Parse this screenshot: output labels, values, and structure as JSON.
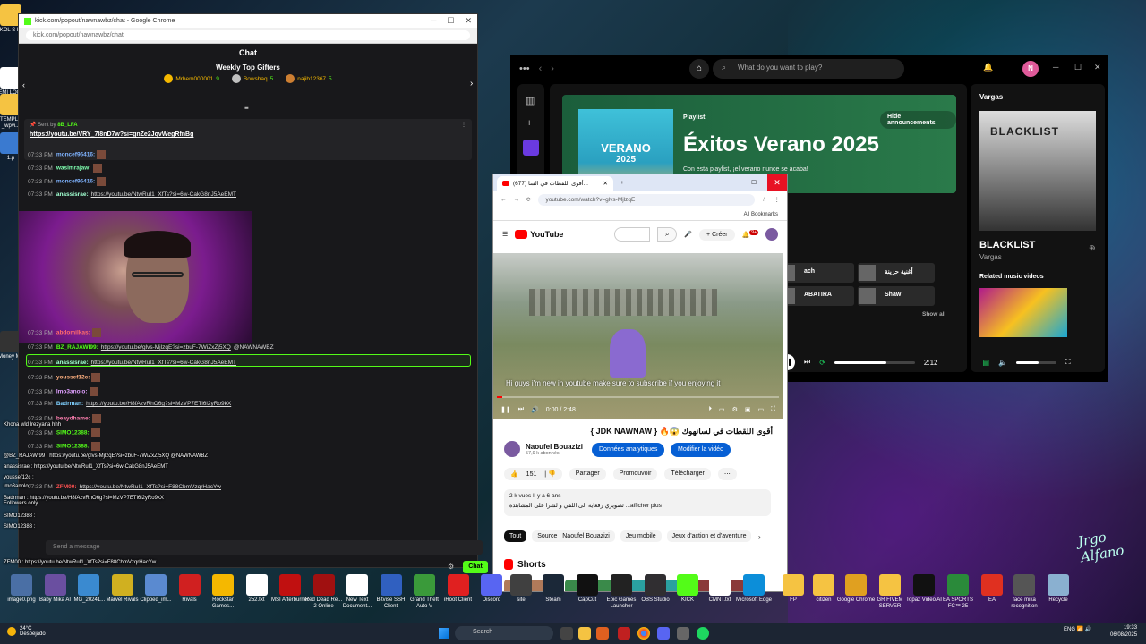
{
  "desktop": {
    "left_icons": [
      {
        "label": "KOL S\nKi",
        "icon": "folder-icon",
        "color": "#f5c342"
      },
      {
        "label": "TEMI\nLOGIN",
        "icon": "file-icon",
        "color": "#ffffff"
      },
      {
        "label": "TEMPLA\n_wpvi...",
        "icon": "folder-icon",
        "color": "#f5c342"
      },
      {
        "label": "1.p",
        "icon": "file-icon",
        "color": "#3a7ad0"
      },
      {
        "label": "Money\nMu",
        "icon": "app-icon",
        "color": "#333333"
      }
    ],
    "bottom_icons": [
      {
        "label": "image0.png",
        "icon": "image-icon",
        "color": "#4a6fa5"
      },
      {
        "label": "Baby Mika AI",
        "icon": "app-icon",
        "color": "#6a4fa0"
      },
      {
        "label": "IMG_20241...",
        "icon": "image-icon",
        "color": "#3a8ad0"
      },
      {
        "label": "Marvel Rivals",
        "icon": "game-icon",
        "color": "#d0b020"
      },
      {
        "label": "Clipped_im...",
        "icon": "file-icon",
        "color": "#5a8ad0"
      },
      {
        "label": "Rivals",
        "icon": "game-icon",
        "color": "#d02020"
      },
      {
        "label": "Rockstar\nGames...",
        "icon": "rockstar-icon",
        "color": "#f5b800"
      },
      {
        "label": "252.txt",
        "icon": "file-icon",
        "color": "#ffffff"
      },
      {
        "label": "MSI\nAfterburner",
        "icon": "app-icon",
        "color": "#c01010"
      },
      {
        "label": "Red Dead\nRe... 2 Online",
        "icon": "game-icon",
        "color": "#a01010"
      },
      {
        "label": "New Text\nDocument...",
        "icon": "file-icon",
        "color": "#ffffff"
      },
      {
        "label": "Bitvise SSH\nClient",
        "icon": "app-icon",
        "color": "#3060c0"
      },
      {
        "label": "Grand Theft\nAuto V",
        "icon": "game-icon",
        "color": "#3a9a3a"
      },
      {
        "label": "iRoot Client",
        "icon": "app-icon",
        "color": "#e02020"
      },
      {
        "label": "Discord",
        "icon": "discord-icon",
        "color": "#5865f2"
      }
    ],
    "right_icons": [
      {
        "label": "site",
        "icon": "app-icon",
        "color": "#404040"
      },
      {
        "label": "Steam",
        "icon": "steam-icon",
        "color": "#1b2838"
      },
      {
        "label": "CapCut",
        "icon": "app-icon",
        "color": "#111111"
      },
      {
        "label": "Epic Games\nLauncher",
        "icon": "app-icon",
        "color": "#222222"
      },
      {
        "label": "OBS Studio",
        "icon": "obs-icon",
        "color": "#302e31"
      },
      {
        "label": "KICK",
        "icon": "kick-icon",
        "color": "#53fc18"
      },
      {
        "label": "CMNT.txt",
        "icon": "file-icon",
        "color": "#ffffff"
      },
      {
        "label": "Microsoft\nEdge",
        "icon": "edge-icon",
        "color": "#0c8ed9"
      },
      {
        "label": "FP",
        "icon": "folder-icon",
        "color": "#f5c342"
      },
      {
        "label": "citizen",
        "icon": "folder-icon",
        "color": "#f5c342"
      },
      {
        "label": "Google\nChrome",
        "icon": "chrome-icon",
        "color": "#e0a020"
      },
      {
        "label": "GR FIVEM\nSERVER",
        "icon": "folder-icon",
        "color": "#f5c342"
      },
      {
        "label": "Topaz Video\nAI",
        "icon": "app-icon",
        "color": "#111111"
      },
      {
        "label": "EA SPORTS\nFC™ 25",
        "icon": "game-icon",
        "color": "#2a8a3a"
      },
      {
        "label": "EA",
        "icon": "ea-icon",
        "color": "#e03020"
      },
      {
        "label": "face mika\nrecognition",
        "icon": "app-icon",
        "color": "#555555"
      },
      {
        "label": "Recycle",
        "icon": "recycle-icon",
        "color": "#8ab0d0"
      }
    ],
    "wallpaper_signature": "Jrgo Alfano"
  },
  "kick": {
    "window_title": "kick.com/popout/nawnawbz/chat - Google Chrome",
    "url": "kick.com/popout/nawnawbz/chat",
    "chat_header": "Chat",
    "gifters_title": "Weekly Top Gifters",
    "gifters": [
      {
        "name": "Mrhem000001",
        "count": "9",
        "medal_color": "#f5b800"
      },
      {
        "name": "Bowshaq",
        "count": "5",
        "medal_color": "#c0c0c0"
      },
      {
        "name": "najib12367",
        "count": "5",
        "medal_color": "#cd7f32"
      }
    ],
    "pinned": {
      "sent_by": "Sent by",
      "sender": "8B_LFA",
      "link": "https://youtu.be/VRY_7l8nD7w?si=gnZe2JqvWegRfnBg"
    },
    "messages": [
      {
        "time": "07:33 PM",
        "user": "moncef96416:",
        "color": "#7fb3ff",
        "text": "",
        "is_link": false
      },
      {
        "time": "07:33 PM",
        "user": "wasimrajaw:",
        "color": "#7fffb0",
        "text": "",
        "is_link": false
      },
      {
        "time": "07:33 PM",
        "user": "moncef96416:",
        "color": "#7fb3ff",
        "text": "",
        "is_link": false
      },
      {
        "time": "07:33 PM",
        "user": "anassisrae:",
        "color": "#a0ffd0",
        "text": "https://youtu.be/NtwRuI1_XfTs?si=6w-CakG8nJ5AeEMT",
        "is_link": true
      }
    ],
    "messages_bottom": [
      {
        "time": "07:33 PM",
        "user": "abdomilkas:",
        "color": "#ff6b6b",
        "text": "",
        "is_link": false
      },
      {
        "time": "07:33 PM",
        "user": "BZ_RAJAWI99:",
        "color": "#53fc18",
        "text": "https://youtu.be/glvs-MjlzqE?si=zbuF-7WiZxZj5XQ",
        "suffix": "@NAWNAWBZ",
        "is_link": true
      },
      {
        "time": "07:33 PM",
        "user": "anassisrae:",
        "color": "#a0ffd0",
        "text": "https://youtu.be/NtwRuI1_XfTs?si=6w-CakG8nJ5AeEMT",
        "is_link": true
      },
      {
        "time": "07:33 PM",
        "user": "youssef12c:",
        "color": "#ffb07f",
        "text": "",
        "is_link": false
      },
      {
        "time": "07:33 PM",
        "user": "lmo3anolo:",
        "color": "#e0a0ff",
        "text": "",
        "is_link": false
      },
      {
        "time": "07:33 PM",
        "user": "Badrman:",
        "color": "#7fd0ff",
        "text": "https://youtu.be/H8fAzvRhO6g?si=MzVP7ETl6i2yRo9kX",
        "is_link": true
      },
      {
        "time": "07:33 PM",
        "user": "beaydhame:",
        "color": "#ff7fb0",
        "text": "",
        "is_link": false
      },
      {
        "time": "07:33 PM",
        "user": "SIMO12388:",
        "color": "#53fc18",
        "text": "",
        "is_link": false
      },
      {
        "time": "07:33 PM",
        "user": "SIMO12388:",
        "color": "#53fc18",
        "text": "",
        "is_link": false
      },
      {
        "time": "07:33 PM",
        "user": "ZFM00:",
        "color": "#ff5050",
        "text": "https://youtu.be/NtwRuI1_XfTs?si=F88CbmVzqrHacYw",
        "is_link": true
      }
    ],
    "overlay_lines": [
      "Khona wld lrezyana hhh",
      "@BZ_RAJAWI99 : https://youtu.be/glvs-MjlzqE?si=zbuF-7WiZxZj5XQ @NAWNAWBZ",
      "anassisrae : https://youtu.be/NtwRuI1_XfTs?si=6w-CakG8nJ5AeEMT",
      "youssef12c :",
      "lmo3anolo :",
      "Badrman : https://youtu.be/H8fAzvRhO6g?si=MzVP7ETl6i2yRo9kX",
      "Followers only",
      "SIMO12388 :",
      "SIMO12388 :",
      "ZFM00 : https://youtu.be/NtwRuI1_XfTs?si=F88CbmVzqrHacYw"
    ],
    "input_placeholder": "Send a message",
    "send_label": "Chat"
  },
  "spotify": {
    "search_placeholder": "What do you want to play?",
    "avatar_letter": "N",
    "playlist_label": "Playlist",
    "banner_title": "Éxitos Verano 2025",
    "banner_desc": "Con esta playlist, ¡el verano nunce se acaba!",
    "hide_label": "Hide announcements",
    "cover_line1": "VERANO",
    "cover_line2": "2025",
    "cards": [
      {
        "label": "ach"
      },
      {
        "label": "أغنية حزينة"
      },
      {
        "label": "ABATIRA"
      },
      {
        "label": "Shaw"
      }
    ],
    "show_all": "Show all",
    "right_artist": "Vargas",
    "art_word": "BLACKLIST",
    "track_title": "BLACKLIST",
    "track_artist": "Vargas",
    "related_title": "Related music videos",
    "time_elapsed": "2:12",
    "progress": 0.65,
    "volume": 0.55
  },
  "youtube": {
    "tab_title": "(677) أقوى اللقطات في السا...",
    "url": "youtube.com/watch?v=glvs-MjlzqE",
    "all_bookmarks": "All Bookmarks",
    "logo_text": "YouTube",
    "create_label": "Créer",
    "notif_count": "9+",
    "subtitle": "Hi guys i'm new in youtube make sure to subscribe if you enjoying it",
    "time_display": "0:00 / 2:48",
    "video_progress": 0.02,
    "video_title": "أقوى اللقطات في لسانهوك 😱🔥 { JDK NAWNAW }",
    "channel_name": "Naoufel Bouazizi",
    "channel_subs": "57,9 k abonnés",
    "btn_analytics": "Données analytiques",
    "btn_edit": "Modifier la vidéo",
    "likes": "151",
    "share": "Partager",
    "promote": "Promouvoir",
    "download": "Télécharger",
    "desc_meta": "2 k vues  Il y a 6 ans",
    "desc_text": "تصويري رقعاية الى اللقي و لشرا على المشاهدة ...afficher plus",
    "chips": [
      {
        "label": "Tout",
        "active": true
      },
      {
        "label": "Source : Naoufel Bouazizi",
        "active": false
      },
      {
        "label": "Jeu mobile",
        "active": false
      },
      {
        "label": "Jeux d'action et d'aventure",
        "active": false
      }
    ],
    "shorts_label": "Shorts"
  },
  "taskbar": {
    "temperature": "24°C",
    "weather": "Despejado",
    "search_placeholder": "Search",
    "lang": "ENG",
    "time": "19:33",
    "date": "06/08/2025"
  }
}
